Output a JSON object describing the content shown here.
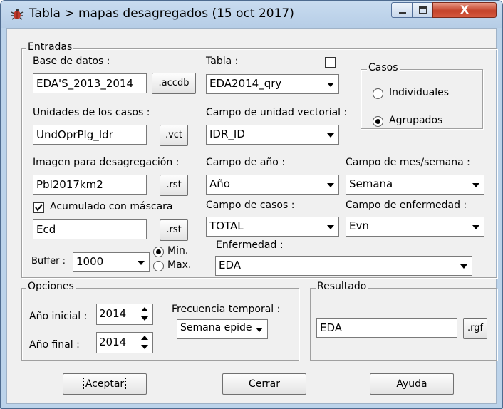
{
  "window": {
    "title": "Tabla > mapas desagregados (15 oct 2017)",
    "close_glyph": "X",
    "icon": "bug-icon"
  },
  "entradas": {
    "legend": "Entradas",
    "base_datos_label": "Base de datos :",
    "base_datos_value": "EDA'S_2013_2014",
    "accdb_button": ".accdb",
    "tabla_label": "Tabla :",
    "tabla_value": "EDA2014_qry",
    "unidades_label": "Unidades de los casos :",
    "unidades_value": "UndOprPlg_Idr",
    "vct_button": ".vct",
    "campo_unidad_label": "Campo de unidad vectorial :",
    "campo_unidad_value": "IDR_ID",
    "imagen_label": "Imagen para desagregación :",
    "imagen_value": "Pbl2017km2",
    "rst_button": ".rst",
    "campo_anio_label": "Campo de año :",
    "campo_anio_value": "Año",
    "campo_mes_label": "Campo de mes/semana :",
    "campo_mes_value": "Semana",
    "acumulado_label": "Acumulado con máscara",
    "acumulado_checked": true,
    "mascara_value": "Ecd",
    "rst_button2": ".rst",
    "campo_casos_label": "Campo de casos :",
    "campo_casos_value": "TOTAL",
    "campo_enf_label": "Campo de enfermedad :",
    "campo_enf_value": "Evn",
    "buffer_label": "Buffer :",
    "buffer_value": "1000",
    "min_label": "Min.",
    "max_label": "Max.",
    "enfermedad_label": "Enfermedad :",
    "enfermedad_value": "EDA"
  },
  "casos": {
    "legend": "Casos",
    "individuales": "Individuales",
    "agrupados": "Agrupados",
    "selected": "agrupados"
  },
  "opciones": {
    "legend": "Opciones",
    "anio_inicial_label": "Año inicial :",
    "anio_inicial_value": "2014",
    "anio_final_label": "Año final :",
    "anio_final_value": "2014",
    "frecuencia_label": "Frecuencia temporal :",
    "frecuencia_value": "Semana epidem"
  },
  "resultado": {
    "legend": "Resultado",
    "value": "EDA",
    "rgf_button": ".rgf"
  },
  "buttons": {
    "aceptar": "Aceptar",
    "cerrar": "Cerrar",
    "ayuda": "Ayuda"
  },
  "colors": {
    "titlebar": "#bcd3ea",
    "close_button": "#c4432b",
    "dialog_bg": "#f0f0f0"
  }
}
